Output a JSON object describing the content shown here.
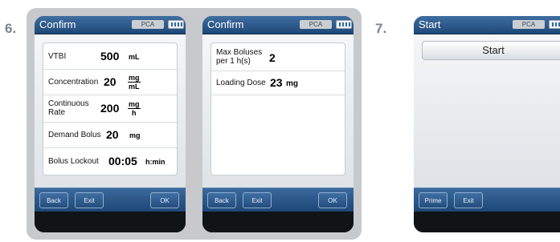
{
  "steps": {
    "six": "6.",
    "seven": "7."
  },
  "screen1": {
    "title": "Confirm",
    "mode": "PCA",
    "rows": {
      "vtbi": {
        "label": "VTBI",
        "value": "500",
        "unit": "mL"
      },
      "concentration": {
        "label": "Concentration",
        "value": "20",
        "unit_num": "mg",
        "unit_den": "mL"
      },
      "continuous_rate": {
        "label_line1": "Continuous",
        "label_line2": "Rate",
        "value": "200",
        "unit_num": "mg",
        "unit_den": "h"
      },
      "demand_bolus": {
        "label": "Demand Bolus",
        "value": "20",
        "unit": "mg"
      },
      "bolus_lockout": {
        "label": "Bolus Lockout",
        "value": "00:05",
        "unit": "h:min"
      }
    },
    "buttons": {
      "back": "Back",
      "exit": "Exit",
      "ok": "OK"
    }
  },
  "screen2": {
    "title": "Confirm",
    "mode": "PCA",
    "rows": {
      "max_boluses": {
        "label_line1": "Max Boluses",
        "label_line2": "per 1 h(s)",
        "value": "2"
      },
      "loading_dose": {
        "label": "Loading Dose",
        "value": "23",
        "unit": "mg"
      }
    },
    "buttons": {
      "back": "Back",
      "exit": "Exit",
      "ok": "OK"
    }
  },
  "screen3": {
    "title": "Start",
    "mode": "PCA",
    "start_button": "Start",
    "buttons": {
      "prime": "Prime",
      "exit": "Exit"
    }
  }
}
